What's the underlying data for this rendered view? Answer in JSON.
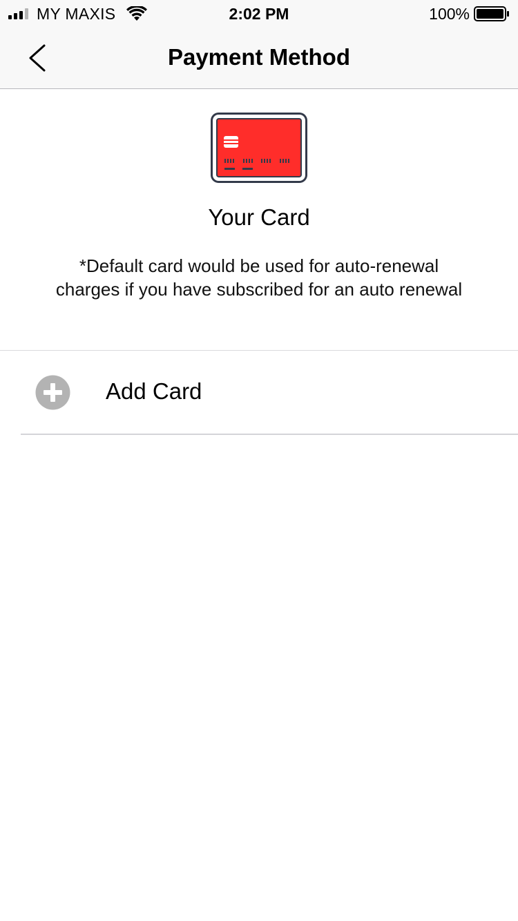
{
  "status_bar": {
    "carrier": "MY MAXIS",
    "time": "2:02 PM",
    "battery": "100%",
    "icons": [
      "signal-icon",
      "wifi-icon",
      "battery-icon"
    ]
  },
  "nav": {
    "title": "Payment Method",
    "back_icon": "chevron-left-icon"
  },
  "card_section": {
    "icon": "credit-card-icon",
    "card_color": "#ff2d2a",
    "title": "Your Card",
    "note_line1": "*Default card would be used for auto-renewal",
    "note_line2": "charges if you have subscribed for an auto renewal"
  },
  "add_card": {
    "icon": "plus-circle-icon",
    "label": "Add Card"
  }
}
